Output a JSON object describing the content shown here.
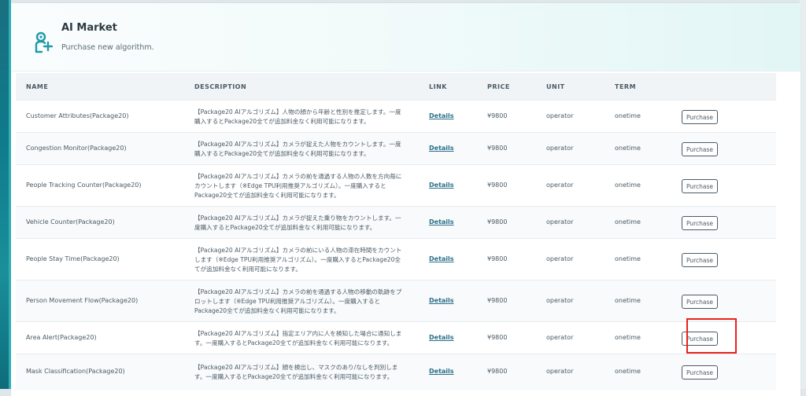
{
  "header": {
    "title": "AI Market",
    "subtitle": "Purchase new algorithm.",
    "icon": "user-plus-icon"
  },
  "table": {
    "columns": [
      "NAME",
      "DESCRIPTION",
      "LINK",
      "PRICE",
      "UNIT",
      "TERM"
    ],
    "rows": [
      {
        "name": "Customer Attributes(Package20)",
        "desc1": "【Package20 AIアルゴリズム】人物の顔から年齢と性別を推定します。一度",
        "desc2": "購入するとPackage20全てが追加料金なく利用可能になります。",
        "desc3": "",
        "link": "Details",
        "price": "¥9800",
        "unit": "operator",
        "term": "onetime",
        "action": "Purchase"
      },
      {
        "name": "Congestion Monitor(Package20)",
        "desc1": "【Package20 AIアルゴリズム】カメラが捉えた人物をカウントします。一度",
        "desc2": "購入するとPackage20全てが追加料金なく利用可能になります。",
        "desc3": "",
        "link": "Details",
        "price": "¥9800",
        "unit": "operator",
        "term": "onetime",
        "action": "Purchase"
      },
      {
        "name": "People Tracking Counter(Package20)",
        "desc1": "【Package20 AIアルゴリズム】カメラの前を通過する人物の人数を方向毎に",
        "desc2": "カウントします（※Edge TPU利用推奨アルゴリズム）。一度購入すると",
        "desc3": "Package20全てが追加料金なく利用可能になります。",
        "link": "Details",
        "price": "¥9800",
        "unit": "operator",
        "term": "onetime",
        "action": "Purchase"
      },
      {
        "name": "Vehicle Counter(Package20)",
        "desc1": "【Package20 AIアルゴリズム】カメラが捉えた乗り物をカウントします。一",
        "desc2": "度購入するとPackage20全てが追加料金なく利用可能になります。",
        "desc3": "",
        "link": "Details",
        "price": "¥9800",
        "unit": "operator",
        "term": "onetime",
        "action": "Purchase"
      },
      {
        "name": "People Stay Time(Package20)",
        "desc1": "【Package20 AIアルゴリズム】カメラの前にいる人物の滞在時間をカウント",
        "desc2": "します（※Edge TPU利用推奨アルゴリズム）。一度購入するとPackage20全",
        "desc3": "てが追加料金なく利用可能になります。",
        "link": "Details",
        "price": "¥9800",
        "unit": "operator",
        "term": "onetime",
        "action": "Purchase"
      },
      {
        "name": "Person Movement Flow(Package20)",
        "desc1": "【Package20 AIアルゴリズム】カメラの前を通過する人物の移動の軌跡をプ",
        "desc2": "ロットします（※Edge TPU利用推奨アルゴリズム）。一度購入すると",
        "desc3": "Package20全てが追加料金なく利用可能になります。",
        "link": "Details",
        "price": "¥9800",
        "unit": "operator",
        "term": "onetime",
        "action": "Purchase"
      },
      {
        "name": "Area Alert(Package20)",
        "desc1": "【Package20 AIアルゴリズム】指定エリア内に人を検知した場合に通知しま",
        "desc2": "す。一度購入するとPackage20全てが追加料金なく利用可能になります。",
        "desc3": "",
        "link": "Details",
        "price": "¥9800",
        "unit": "operator",
        "term": "onetime",
        "action": "Purchase"
      },
      {
        "name": "Mask Classification(Package20)",
        "desc1": "【Package20 AIアルゴリズム】顔を検出し、マスクのあり/なしを判別しま",
        "desc2": "す。一度購入するとPackage20全てが追加料金なく利用可能になります。",
        "desc3": "",
        "link": "Details",
        "price": "¥9800",
        "unit": "operator",
        "term": "onetime",
        "action": "Purchase"
      }
    ]
  },
  "colors": {
    "accent": "#2b6f8a",
    "highlight": "#e8221c",
    "sidebar": "#0f7a8a"
  }
}
